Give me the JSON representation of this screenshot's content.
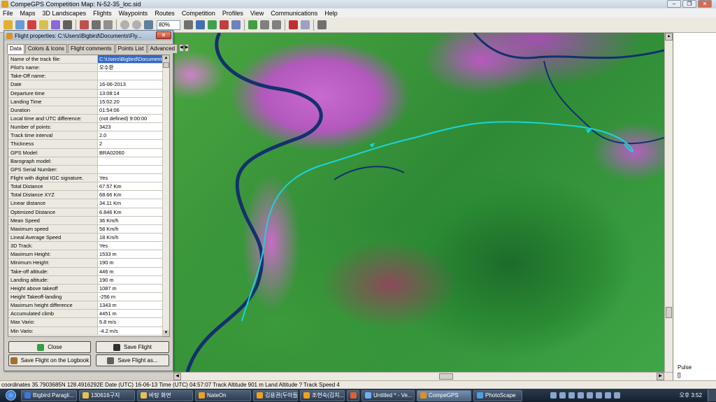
{
  "window": {
    "title": "CompeGPS Competition Map: N-52-35_loc.sid"
  },
  "menu": [
    "File",
    "Maps",
    "3D Landscapes",
    "Flights",
    "Waypoints",
    "Routes",
    "Competition",
    "Profiles",
    "View",
    "Communications",
    "Help"
  ],
  "toolbar": {
    "zoom_value": "80%"
  },
  "dialog": {
    "title": "Flight properties: C:\\Users\\Bigbird\\Documents\\Fly...",
    "tabs": [
      "Data",
      "Colors & Icons",
      "Flight comments",
      "Points List",
      "Advanced"
    ],
    "rows": [
      {
        "key": "Name of the track file:",
        "value": "C:\\Users\\Bigbird\\Documents"
      },
      {
        "key": "Pilot's name:",
        "value": "오수환"
      },
      {
        "key": "Take-Off name:",
        "value": ""
      },
      {
        "key": "Date",
        "value": "16-06-2013"
      },
      {
        "key": "Departure time",
        "value": "13:08:14"
      },
      {
        "key": "Landing Time",
        "value": "15:02:20"
      },
      {
        "key": "Duration",
        "value": "01:54:06"
      },
      {
        "key": "Local time and UTC difference:",
        "value": "(not defined) 9:00:00"
      },
      {
        "key": "Number of points:",
        "value": "3423"
      },
      {
        "key": "Track time interval",
        "value": "2.0"
      },
      {
        "key": "Thickness",
        "value": "2"
      },
      {
        "key": "GPS Model:",
        "value": "BRA02060"
      },
      {
        "key": "Barograph model:",
        "value": ""
      },
      {
        "key": "GPS Serial Number:",
        "value": ""
      },
      {
        "key": "Flight with digital IGC signature.",
        "value": "Yes"
      },
      {
        "key": "Total Distance",
        "value": "67.57 Km"
      },
      {
        "key": "Total Distance XYZ",
        "value": "68.66 Km"
      },
      {
        "key": "Linear distance",
        "value": "34.11 Km"
      },
      {
        "key": "Optimized Distance",
        "value": "6.846 Km"
      },
      {
        "key": "Mean Speed",
        "value": "36 Km/h"
      },
      {
        "key": "Maximum speed",
        "value": "58 Km/h"
      },
      {
        "key": "Lineal Average Speed",
        "value": "18 Km/h"
      },
      {
        "key": "3D Track:",
        "value": "Yes"
      },
      {
        "key": "Maximum Height:",
        "value": "1533 m"
      },
      {
        "key": "Minimum Height:",
        "value": "190 m"
      },
      {
        "key": "Take-off altitude:",
        "value": "446 m"
      },
      {
        "key": "Landing altitude:",
        "value": "190 m"
      },
      {
        "key": "Height above takeoff",
        "value": "1087 m"
      },
      {
        "key": "Height Takeoff-landing",
        "value": "-256 m"
      },
      {
        "key": "Maximum height difference",
        "value": "1343 m"
      },
      {
        "key": "Accumulated climb",
        "value": "4451 m"
      },
      {
        "key": "Max Vario:",
        "value": "5.8 m/s"
      },
      {
        "key": "Min Vario:",
        "value": "-4.2 m/s"
      }
    ],
    "buttons": {
      "close": "Close",
      "save": "Save Flight",
      "logbook": "Save Flight on the Logbook",
      "save_as": "Save Flight as..."
    }
  },
  "right_panel": {
    "label": "Pulse",
    "value": "[]"
  },
  "status": {
    "text": "coordinates 35.7903685N 128.4916292E Date (UTC) 16-06-13 Time (UTC) 04:57:07 Track Altitude 901 m Land Altitude ? Track Speed 4"
  },
  "taskbar": {
    "items": [
      {
        "label": "Bigbird Paragli...",
        "color": "#3a7ad8"
      },
      {
        "label": "130616구지",
        "color": "#e8c050"
      },
      {
        "label": "바탕 화면",
        "color": "#e8c050"
      },
      {
        "label": "NateOn",
        "color": "#f0a020"
      },
      {
        "label": "김용권(두아들...",
        "color": "#f0a020"
      },
      {
        "label": "조현숙(김치....",
        "color": "#f0a020"
      },
      {
        "label": "",
        "color": "#e06030"
      },
      {
        "label": "Untitled * - Ve...",
        "color": "#70b0f0"
      },
      {
        "label": "CompeGPS",
        "color": "#e09020"
      },
      {
        "label": "PhotoScape",
        "color": "#50a0e0"
      }
    ],
    "clock": "오후 3:52"
  },
  "colors": {
    "track": "#19d4dc",
    "river": "#14306e"
  }
}
